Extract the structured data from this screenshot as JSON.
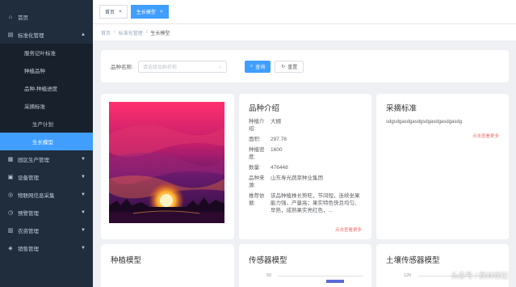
{
  "sidebar": {
    "items": [
      {
        "icon": "home-icon",
        "glyph": "⌂",
        "label": "首页"
      },
      {
        "icon": "grid-icon",
        "glyph": "▤",
        "label": "标准化管理",
        "expanded": true
      }
    ],
    "sub_items": [
      {
        "label": "服务记叶标准"
      },
      {
        "label": "种植品种"
      },
      {
        "label": "品种-种植进度"
      },
      {
        "label": "采摘标准"
      },
      {
        "label": "生产计划"
      },
      {
        "label": "生长模型",
        "active": true
      }
    ],
    "items_after": [
      {
        "icon": "calendar-icon",
        "glyph": "▦",
        "label": "园区生产管理"
      },
      {
        "icon": "device-icon",
        "glyph": "▣",
        "label": "设备管理"
      },
      {
        "icon": "iot-icon",
        "glyph": "◎",
        "label": "物联网信息采集"
      },
      {
        "icon": "warning-icon",
        "glyph": "◷",
        "label": "预警管理"
      },
      {
        "icon": "farm-icon",
        "glyph": "▥",
        "label": "农资管理"
      },
      {
        "icon": "sales-icon",
        "glyph": "◈",
        "label": "销售管理"
      }
    ]
  },
  "tabs": [
    {
      "label": "首页",
      "close": "×"
    },
    {
      "label": "生长模型",
      "close": "×",
      "active": true
    }
  ],
  "breadcrumb": {
    "home": "首页",
    "parent": "标准化管理",
    "current": "生长模型",
    "sep": "/"
  },
  "search": {
    "label": "品种名称:",
    "placeholder": "请选择品种名称",
    "query_button": "查询",
    "reset_button": "重置"
  },
  "intro": {
    "title": "品种介绍",
    "rows": [
      {
        "key": "种植介绍:",
        "value": "大棚"
      },
      {
        "key": "面积:",
        "value": "297.78"
      },
      {
        "key": "种植密度:",
        "value": "1600"
      },
      {
        "key": "数量:",
        "value": "476448"
      },
      {
        "key": "品种来源:",
        "value": "山东寿光蔬菜种业集团"
      },
      {
        "key": "推荐依据:",
        "value": "该品种植株长势旺，节间短，连续坐果能力强，产量高；果实特色快且均匀、早熟，成熟果实亮红色，..."
      }
    ],
    "more": "点击查看更多"
  },
  "standard": {
    "title": "采摘标准",
    "text": "sdgsdgasdgasdgsdgasdgasdgasdg",
    "more": "点击查看更多"
  },
  "bottom": {
    "plant_title": "种植模型",
    "sensor_title": "传感器模型",
    "sensor_axis": "50",
    "soil_title": "土壤传感器模型",
    "soil_axis": "120"
  },
  "watermark": "头条号 / 枫林世纪",
  "colors": {
    "sidebar_bg": "#1f2d3d",
    "accent": "#409eff",
    "link_red": "#f56c6c"
  }
}
